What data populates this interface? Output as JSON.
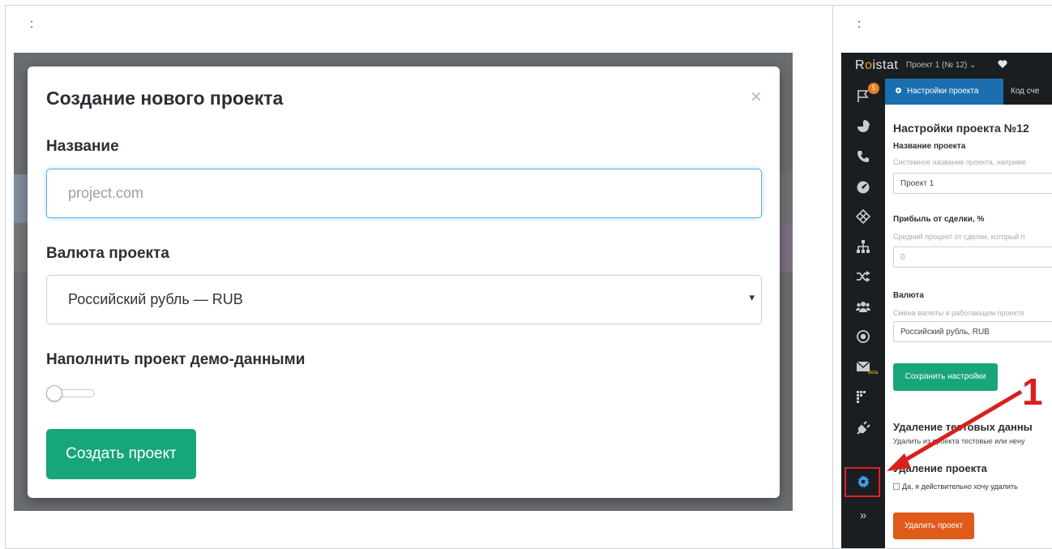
{
  "left": {
    "colon": ":",
    "modal": {
      "title": "Создание нового проекта",
      "close_glyph": "×",
      "name_label": "Название",
      "name_placeholder": "project.com",
      "currency_label": "Валюта проекта",
      "currency_value": "Российский рубль — RUB",
      "currency_caret": "▾",
      "demo_label": "Наполнить проект демо-данными",
      "demo_toggle_on": false,
      "create_button": "Создать проект"
    }
  },
  "right": {
    "colon": ":",
    "topbar": {
      "logo_prefix": "R",
      "logo_o": "o",
      "logo_suffix": "istat",
      "project_switcher": "Проект 1  (№ 12) ⌄"
    },
    "sidebar": {
      "flag_badge": "5",
      "beta_label": "Beta",
      "items": [
        "flag-icon",
        "pie-chart-icon",
        "phone-icon",
        "dashboard-icon",
        "crosshair-icon",
        "sitemap-icon",
        "shuffle-icon",
        "users-icon",
        "target-icon",
        "envelope-icon",
        "heatmap-icon",
        "plug-icon",
        "gear-icon",
        "expand-icon"
      ],
      "active_item": "gear-icon",
      "expand_glyph": "»"
    },
    "tabs": {
      "active": "Настройки проекта",
      "next": "Код сче"
    },
    "settings": {
      "title": "Настройки проекта №12",
      "name_label": "Название проекта",
      "name_help": "Системное название проекта, наприме",
      "name_value": "Проект 1",
      "profit_label": "Прибыль от сделки, %",
      "profit_help": "Средний процент от сделки, который п",
      "profit_value": "0",
      "currency_label": "Валюта",
      "currency_help": "Смена валюты в работающем проекте",
      "currency_value": "Российский рубль, RUB",
      "save_button": "Сохранить настройки",
      "test_data_title": "Удаление тестовых данны",
      "test_data_help": "Удалить из проекта тестовые или нену",
      "delete_title": "Удаление проекта",
      "confirm_text": "Да, я действительно хочу удалить",
      "delete_button": "Удалить проект"
    },
    "annotation": {
      "number": "1",
      "color": "#d8201c"
    }
  },
  "colors": {
    "accent_green": "#17a57a",
    "tab_blue": "#1b6fb0",
    "dark_sidebar": "#1b1e21",
    "delete_orange": "#e05a1a",
    "focus_blue": "#66afe9"
  }
}
